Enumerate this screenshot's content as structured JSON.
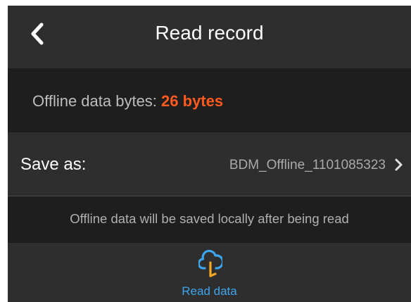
{
  "header": {
    "title": "Read record",
    "back_icon": "chevron-left-icon"
  },
  "offline": {
    "label": "Offline data bytes: ",
    "value": "26 bytes",
    "value_color": "#ff5a1f"
  },
  "save": {
    "label": "Save as:",
    "filename": "BDM_Offline_1101085323",
    "chevron_icon": "chevron-right-icon"
  },
  "note": {
    "text": "Offline data will be saved locally after being read"
  },
  "action": {
    "label": "Read data",
    "icon": "cloud-download-icon",
    "accent_color": "#3da5ec",
    "arrow_color": "#f5a623"
  }
}
